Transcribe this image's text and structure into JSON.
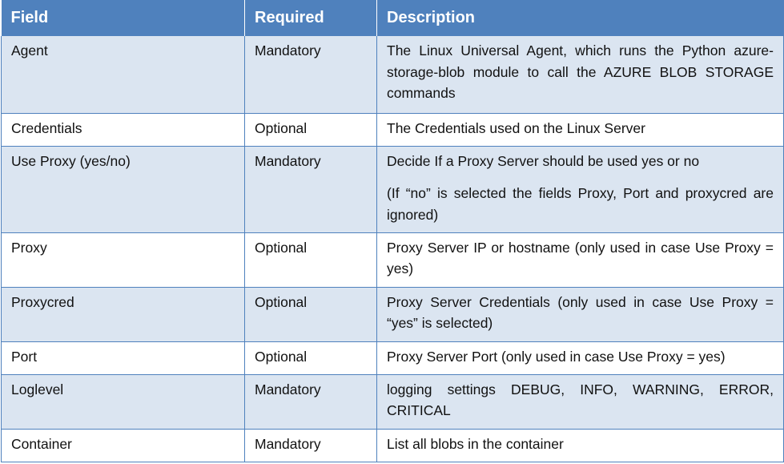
{
  "table": {
    "headers": [
      "Field",
      "Required",
      "Description"
    ],
    "rows": [
      {
        "field": "Agent",
        "required": "Mandatory",
        "description": "The Linux Universal Agent, which runs the Python azure-storage-blob module to call the AZURE BLOB STORAGE commands",
        "note": ""
      },
      {
        "field": "Credentials",
        "required": "Optional",
        "description": "The Credentials used on the Linux Server",
        "note": ""
      },
      {
        "field": "Use Proxy (yes/no)",
        "required": "Mandatory",
        "description": "Decide If a Proxy Server should be used yes or no",
        "note": "(If “no” is selected the fields Proxy, Port and proxycred are ignored)"
      },
      {
        "field": "Proxy",
        "required": "Optional",
        "description": "Proxy Server IP or hostname (only used in case Use Proxy = yes)",
        "note": ""
      },
      {
        "field": "Proxycred",
        "required": "Optional",
        "description": "Proxy Server Credentials (only used in case Use Proxy = “yes” is selected)",
        "note": ""
      },
      {
        "field": "Port",
        "required": "Optional",
        "description": "Proxy Server Port (only used in case Use Proxy = yes)",
        "note": ""
      },
      {
        "field": "Loglevel",
        "required": "Mandatory",
        "description": "logging settings DEBUG, INFO, WARNING, ERROR, CRITICAL",
        "note": ""
      },
      {
        "field": "Container",
        "required": "Mandatory",
        "description": "List all blobs in the container",
        "note": ""
      }
    ]
  },
  "colors": {
    "header_bg": "#4f81bd",
    "header_text": "#ffffff",
    "row_shade": "#dbe5f1",
    "row_plain": "#ffffff",
    "border": "#4f81bd"
  }
}
